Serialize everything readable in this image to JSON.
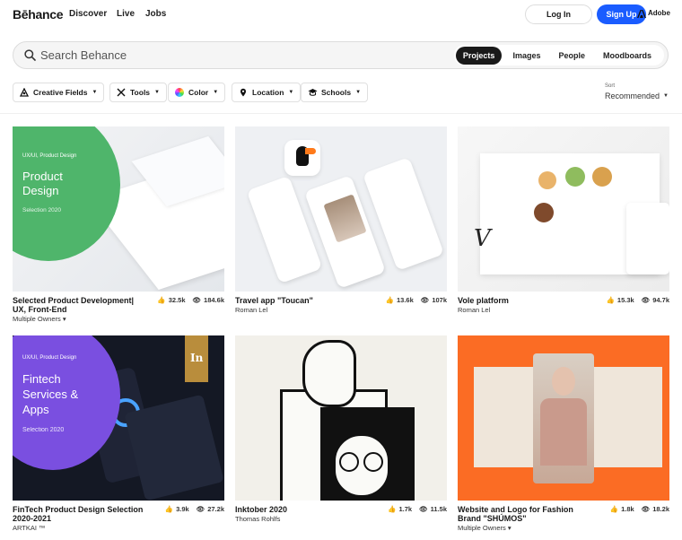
{
  "header": {
    "logo": "Bēhance",
    "nav": [
      "Discover",
      "Live",
      "Jobs"
    ],
    "login": "Log In",
    "signup": "Sign Up",
    "adobe": "Adobe",
    "accent": "#1a5cff"
  },
  "search": {
    "placeholder": "Search Behance",
    "tabs": [
      "Projects",
      "Images",
      "People",
      "Moodboards"
    ],
    "active_tab": "Projects"
  },
  "filters": [
    "Creative Fields",
    "Tools",
    "Color",
    "Location",
    "Schools"
  ],
  "sort": {
    "label": "Sort",
    "value": "Recommended"
  },
  "projects": [
    {
      "title": "Selected Product Development| UX, Front-End",
      "owner": "Multiple Owners",
      "owner_dropdown": true,
      "likes": "32.5k",
      "views": "184.6k",
      "art": {
        "kicker": "UX/UI, Product Design",
        "heading": "Product Design",
        "sub": "Selection 2020"
      }
    },
    {
      "title": "Travel app \"Toucan\"",
      "owner": "Roman Lel",
      "likes": "13.6k",
      "views": "107k"
    },
    {
      "title": "Vole platform",
      "owner": "Roman Lel",
      "likes": "15.3k",
      "views": "94.7k"
    },
    {
      "title": "FinTech Product Design Selection 2020-2021",
      "owner": "ARTKAI ™",
      "likes": "3.9k",
      "views": "27.2k",
      "art": {
        "kicker": "UX/UI, Product Design",
        "heading": "Fintech Services & Apps",
        "sub": "Selection 2020",
        "badge": "In"
      }
    },
    {
      "title": "Inktober 2020",
      "owner": "Thomas Rohlfs",
      "likes": "1.7k",
      "views": "11.5k"
    },
    {
      "title": "Website and Logo for Fashion Brand \"SHÚMOS\"",
      "owner": "Multiple Owners",
      "owner_dropdown": true,
      "likes": "1.8k",
      "views": "18.2k"
    }
  ]
}
